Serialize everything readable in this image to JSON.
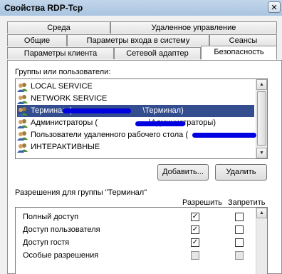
{
  "window": {
    "title": "Свойства RDP-Tcp",
    "close_glyph": "✕"
  },
  "tabs": {
    "row1": [
      "Среда",
      "Удаленное управление"
    ],
    "row2": [
      "Общие",
      "Параметры входа в систему",
      "Сеансы"
    ],
    "row3": [
      "Параметры клиента",
      "Сетевой адаптер",
      "Безопасность"
    ],
    "active": "Безопасность"
  },
  "groups": {
    "label": "Группы или пользователи:",
    "items": [
      {
        "name": "LOCAL SERVICE",
        "icon": "users-icon"
      },
      {
        "name": "NETWORK SERVICE",
        "icon": "users-icon"
      },
      {
        "name_prefix": "Терминал (",
        "name_suffix": "\\Терминал)",
        "icon": "users-icon",
        "selected": true
      },
      {
        "name_prefix": "Администраторы (",
        "name_suffix": "\\Администраторы)",
        "icon": "users-icon"
      },
      {
        "name_prefix": "Пользователи удаленного рабочего стола (",
        "icon": "users-icon"
      },
      {
        "name": "ИНТЕРАКТИВНЫЕ",
        "icon": "users-icon"
      }
    ]
  },
  "buttons": {
    "add": "Добавить...",
    "remove": "Удалить"
  },
  "permissions": {
    "label": "Разрешения для группы \"Терминал\"",
    "allow_header": "Разрешить",
    "deny_header": "Запретить",
    "rows": [
      {
        "name": "Полный доступ",
        "allow": true,
        "deny": false,
        "disabled": false
      },
      {
        "name": "Доступ пользователя",
        "allow": true,
        "deny": false,
        "disabled": false
      },
      {
        "name": "Доступ гостя",
        "allow": true,
        "deny": false,
        "disabled": false
      },
      {
        "name": "Особые разрешения",
        "allow": false,
        "deny": false,
        "disabled": true
      }
    ]
  },
  "check_glyph": "✓",
  "colors": {
    "selection": "#334d8f",
    "redaction": "#0000e0"
  }
}
